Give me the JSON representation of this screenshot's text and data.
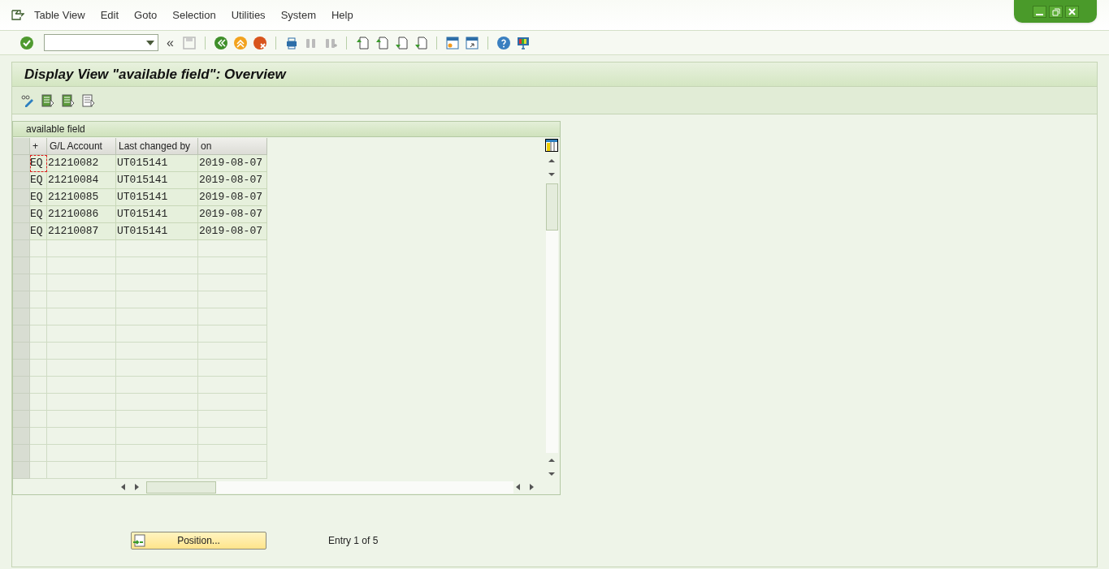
{
  "menu": [
    "Table View",
    "Edit",
    "Goto",
    "Selection",
    "Utilities",
    "System",
    "Help"
  ],
  "toolbar_back": "«",
  "title": "Display View \"available field\": Overview",
  "table": {
    "caption": "available field",
    "columns": [
      "+",
      "G/L Account",
      "Last changed by",
      "on"
    ],
    "rows": [
      {
        "cells": [
          "EQ",
          "21210082",
          "UT015141",
          "2019-08-07"
        ],
        "focused": true
      },
      {
        "cells": [
          "EQ",
          "21210084",
          "UT015141",
          "2019-08-07"
        ],
        "focused": false
      },
      {
        "cells": [
          "EQ",
          "21210085",
          "UT015141",
          "2019-08-07"
        ],
        "focused": false
      },
      {
        "cells": [
          "EQ",
          "21210086",
          "UT015141",
          "2019-08-07"
        ],
        "focused": false
      },
      {
        "cells": [
          "EQ",
          "21210087",
          "UT015141",
          "2019-08-07"
        ],
        "focused": false
      }
    ]
  },
  "position_button": "Position...",
  "entry_info": "Entry 1 of 5"
}
